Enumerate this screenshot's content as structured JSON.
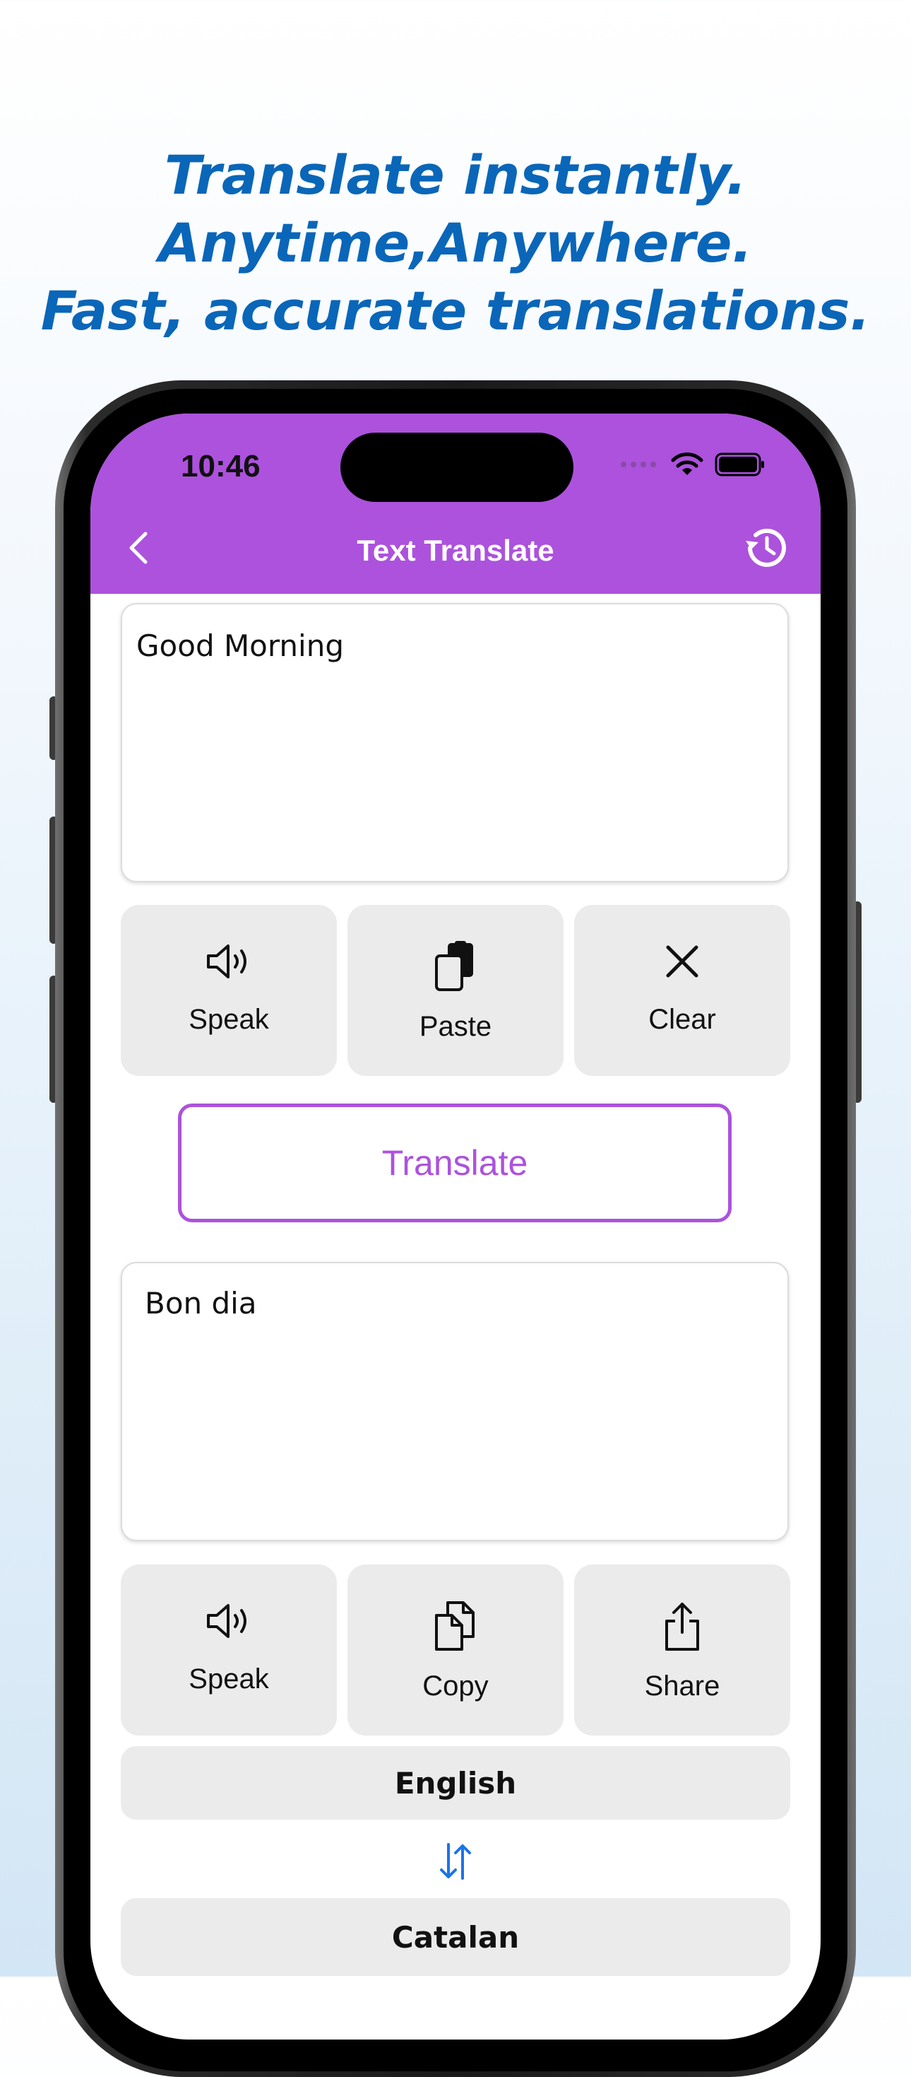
{
  "promo": {
    "line1": "Translate instantly.",
    "line2": "Anytime,Anywhere.",
    "line3": "Fast, accurate translations."
  },
  "status_bar": {
    "time": "10:46"
  },
  "nav": {
    "title": "Text Translate",
    "back_icon": "chevron-left-icon",
    "history_icon": "history-clock-icon"
  },
  "input": {
    "text": "Good Morning"
  },
  "input_actions": [
    {
      "label": "Speak",
      "icon": "speaker-icon"
    },
    {
      "label": "Paste",
      "icon": "paste-icon"
    },
    {
      "label": "Clear",
      "icon": "close-icon"
    }
  ],
  "translate_button": "Translate",
  "output": {
    "text": "Bon dia"
  },
  "output_actions": [
    {
      "label": "Speak",
      "icon": "speaker-icon"
    },
    {
      "label": "Copy",
      "icon": "copy-icon"
    },
    {
      "label": "Share",
      "icon": "share-icon"
    }
  ],
  "languages": {
    "source": "English",
    "target": "Catalan",
    "swap_icon": "swap-arrows-icon"
  },
  "colors": {
    "accent": "#ac52dd",
    "headline": "#0a66b8",
    "button_bg": "#ebebeb",
    "swap": "#1a73e8"
  }
}
